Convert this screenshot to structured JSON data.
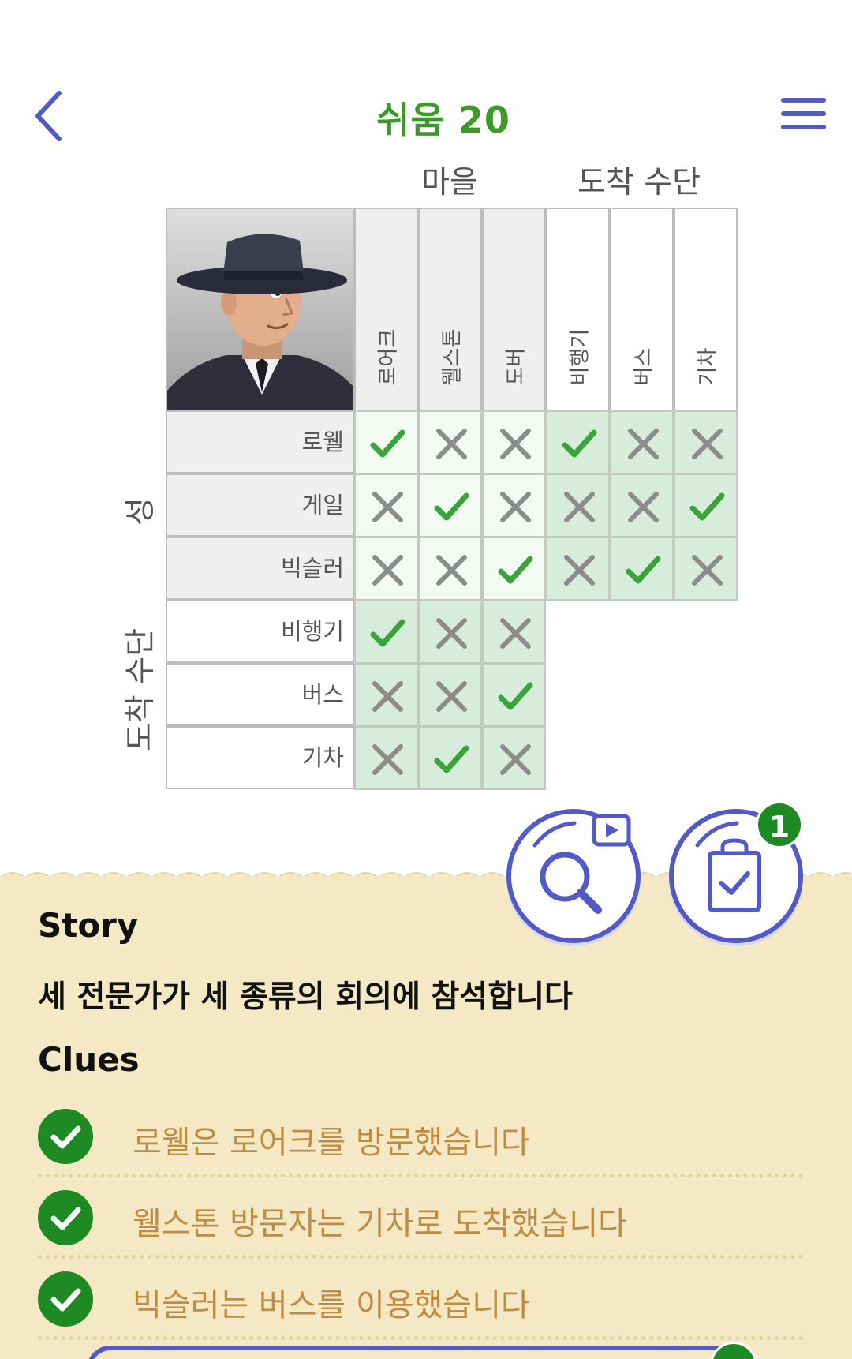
{
  "header": {
    "title": "쉬움 20",
    "back_icon": "chevron-left-icon",
    "menu_icon": "hamburger-menu-icon"
  },
  "grid": {
    "column_groups": [
      "마을",
      "도착 수단"
    ],
    "columns": [
      "로어크",
      "웰스톤",
      "도버",
      "비행기",
      "버스",
      "기차"
    ],
    "row_groups": [
      "성",
      "도착 수단"
    ],
    "rows": [
      "로웰",
      "게일",
      "빅슬러",
      "비행기",
      "버스",
      "기차"
    ],
    "marks": [
      [
        "check",
        "x",
        "x",
        "check",
        "x",
        "x"
      ],
      [
        "x",
        "check",
        "x",
        "x",
        "x",
        "check"
      ],
      [
        "x",
        "x",
        "check",
        "x",
        "check",
        "x"
      ],
      [
        "check",
        "x",
        "x"
      ],
      [
        "x",
        "x",
        "check"
      ],
      [
        "x",
        "check",
        "x"
      ]
    ]
  },
  "buttons": {
    "hint_icon": "magnifier-video-icon",
    "notes_icon": "clipboard-check-icon",
    "notes_badge": "1"
  },
  "story": {
    "title": "Story",
    "text": "세 전문가가 세 종류의 회의에 참석합니다"
  },
  "clues": {
    "title": "Clues",
    "items": [
      {
        "text": "로웰은 로어크를 방문했습니다",
        "solved": true
      },
      {
        "text": "웰스톤 방문자는 기차로 도착했습니다",
        "solved": true
      },
      {
        "text": "빅슬러는 버스를 이용했습니다",
        "solved": true
      }
    ]
  },
  "colors": {
    "accent": "#5259c8",
    "check": "#3aa33a",
    "title": "#3b9b26",
    "clue_text": "#c08b42"
  }
}
